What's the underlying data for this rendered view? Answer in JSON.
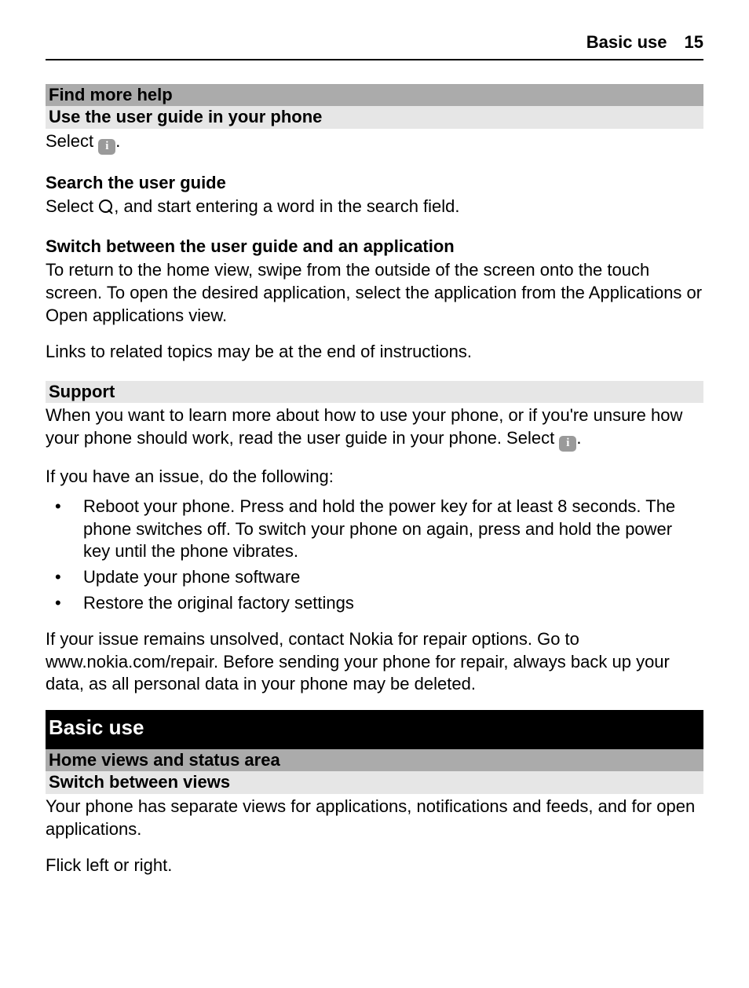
{
  "header": {
    "title": "Basic use",
    "page": "15"
  },
  "s1": {
    "h": "Find more help",
    "sub": "Use the user guide in your phone",
    "select": "Select",
    "period": "."
  },
  "s2": {
    "h": "Search the user guide",
    "pre": "Select",
    "post": ", and start entering a word in the search field."
  },
  "s3": {
    "h": "Switch between the user guide and an application",
    "p": "To return to the home view, swipe from the outside of the screen onto the touch screen. To open the desired application, select the application from the Applications or Open applications view.",
    "p2": "Links to related topics may be at the end of instructions."
  },
  "s4": {
    "h": "Support",
    "p1a": "When you want to learn more about how to use your phone, or if you're unsure how your phone should work, read the user guide in your phone. Select ",
    "p1b": ".",
    "p2": "If you have an issue, do the following:",
    "b1": "Reboot your phone. Press and hold the power key for at least 8 seconds. The phone switches off. To switch your phone on again, press and hold the power key until the phone vibrates.",
    "b2": "Update your phone software",
    "b3": "Restore the original factory settings",
    "p3": "If your issue remains unsolved, contact Nokia for repair options. Go to www.nokia.com/repair. Before sending your phone for repair, always back up your data, as all personal data in your phone may be deleted."
  },
  "s5": {
    "big": "Basic use",
    "sub1": "Home views and status area",
    "sub2": "Switch between views",
    "p1": "Your phone has separate views for applications, notifications and feeds, and for open applications.",
    "p2": "Flick left or right."
  }
}
